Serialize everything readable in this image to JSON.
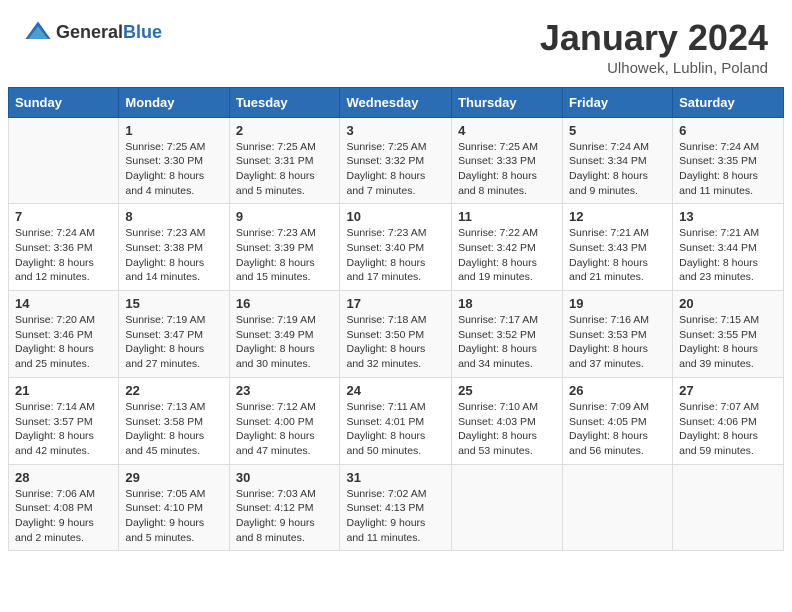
{
  "header": {
    "logo_general": "General",
    "logo_blue": "Blue",
    "month_title": "January 2024",
    "location": "Ulhowek, Lublin, Poland"
  },
  "days_of_week": [
    "Sunday",
    "Monday",
    "Tuesday",
    "Wednesday",
    "Thursday",
    "Friday",
    "Saturday"
  ],
  "weeks": [
    [
      {
        "day": "",
        "sunrise": "",
        "sunset": "",
        "daylight": ""
      },
      {
        "day": "1",
        "sunrise": "Sunrise: 7:25 AM",
        "sunset": "Sunset: 3:30 PM",
        "daylight": "Daylight: 8 hours and 4 minutes."
      },
      {
        "day": "2",
        "sunrise": "Sunrise: 7:25 AM",
        "sunset": "Sunset: 3:31 PM",
        "daylight": "Daylight: 8 hours and 5 minutes."
      },
      {
        "day": "3",
        "sunrise": "Sunrise: 7:25 AM",
        "sunset": "Sunset: 3:32 PM",
        "daylight": "Daylight: 8 hours and 7 minutes."
      },
      {
        "day": "4",
        "sunrise": "Sunrise: 7:25 AM",
        "sunset": "Sunset: 3:33 PM",
        "daylight": "Daylight: 8 hours and 8 minutes."
      },
      {
        "day": "5",
        "sunrise": "Sunrise: 7:24 AM",
        "sunset": "Sunset: 3:34 PM",
        "daylight": "Daylight: 8 hours and 9 minutes."
      },
      {
        "day": "6",
        "sunrise": "Sunrise: 7:24 AM",
        "sunset": "Sunset: 3:35 PM",
        "daylight": "Daylight: 8 hours and 11 minutes."
      }
    ],
    [
      {
        "day": "7",
        "sunrise": "Sunrise: 7:24 AM",
        "sunset": "Sunset: 3:36 PM",
        "daylight": "Daylight: 8 hours and 12 minutes."
      },
      {
        "day": "8",
        "sunrise": "Sunrise: 7:23 AM",
        "sunset": "Sunset: 3:38 PM",
        "daylight": "Daylight: 8 hours and 14 minutes."
      },
      {
        "day": "9",
        "sunrise": "Sunrise: 7:23 AM",
        "sunset": "Sunset: 3:39 PM",
        "daylight": "Daylight: 8 hours and 15 minutes."
      },
      {
        "day": "10",
        "sunrise": "Sunrise: 7:23 AM",
        "sunset": "Sunset: 3:40 PM",
        "daylight": "Daylight: 8 hours and 17 minutes."
      },
      {
        "day": "11",
        "sunrise": "Sunrise: 7:22 AM",
        "sunset": "Sunset: 3:42 PM",
        "daylight": "Daylight: 8 hours and 19 minutes."
      },
      {
        "day": "12",
        "sunrise": "Sunrise: 7:21 AM",
        "sunset": "Sunset: 3:43 PM",
        "daylight": "Daylight: 8 hours and 21 minutes."
      },
      {
        "day": "13",
        "sunrise": "Sunrise: 7:21 AM",
        "sunset": "Sunset: 3:44 PM",
        "daylight": "Daylight: 8 hours and 23 minutes."
      }
    ],
    [
      {
        "day": "14",
        "sunrise": "Sunrise: 7:20 AM",
        "sunset": "Sunset: 3:46 PM",
        "daylight": "Daylight: 8 hours and 25 minutes."
      },
      {
        "day": "15",
        "sunrise": "Sunrise: 7:19 AM",
        "sunset": "Sunset: 3:47 PM",
        "daylight": "Daylight: 8 hours and 27 minutes."
      },
      {
        "day": "16",
        "sunrise": "Sunrise: 7:19 AM",
        "sunset": "Sunset: 3:49 PM",
        "daylight": "Daylight: 8 hours and 30 minutes."
      },
      {
        "day": "17",
        "sunrise": "Sunrise: 7:18 AM",
        "sunset": "Sunset: 3:50 PM",
        "daylight": "Daylight: 8 hours and 32 minutes."
      },
      {
        "day": "18",
        "sunrise": "Sunrise: 7:17 AM",
        "sunset": "Sunset: 3:52 PM",
        "daylight": "Daylight: 8 hours and 34 minutes."
      },
      {
        "day": "19",
        "sunrise": "Sunrise: 7:16 AM",
        "sunset": "Sunset: 3:53 PM",
        "daylight": "Daylight: 8 hours and 37 minutes."
      },
      {
        "day": "20",
        "sunrise": "Sunrise: 7:15 AM",
        "sunset": "Sunset: 3:55 PM",
        "daylight": "Daylight: 8 hours and 39 minutes."
      }
    ],
    [
      {
        "day": "21",
        "sunrise": "Sunrise: 7:14 AM",
        "sunset": "Sunset: 3:57 PM",
        "daylight": "Daylight: 8 hours and 42 minutes."
      },
      {
        "day": "22",
        "sunrise": "Sunrise: 7:13 AM",
        "sunset": "Sunset: 3:58 PM",
        "daylight": "Daylight: 8 hours and 45 minutes."
      },
      {
        "day": "23",
        "sunrise": "Sunrise: 7:12 AM",
        "sunset": "Sunset: 4:00 PM",
        "daylight": "Daylight: 8 hours and 47 minutes."
      },
      {
        "day": "24",
        "sunrise": "Sunrise: 7:11 AM",
        "sunset": "Sunset: 4:01 PM",
        "daylight": "Daylight: 8 hours and 50 minutes."
      },
      {
        "day": "25",
        "sunrise": "Sunrise: 7:10 AM",
        "sunset": "Sunset: 4:03 PM",
        "daylight": "Daylight: 8 hours and 53 minutes."
      },
      {
        "day": "26",
        "sunrise": "Sunrise: 7:09 AM",
        "sunset": "Sunset: 4:05 PM",
        "daylight": "Daylight: 8 hours and 56 minutes."
      },
      {
        "day": "27",
        "sunrise": "Sunrise: 7:07 AM",
        "sunset": "Sunset: 4:06 PM",
        "daylight": "Daylight: 8 hours and 59 minutes."
      }
    ],
    [
      {
        "day": "28",
        "sunrise": "Sunrise: 7:06 AM",
        "sunset": "Sunset: 4:08 PM",
        "daylight": "Daylight: 9 hours and 2 minutes."
      },
      {
        "day": "29",
        "sunrise": "Sunrise: 7:05 AM",
        "sunset": "Sunset: 4:10 PM",
        "daylight": "Daylight: 9 hours and 5 minutes."
      },
      {
        "day": "30",
        "sunrise": "Sunrise: 7:03 AM",
        "sunset": "Sunset: 4:12 PM",
        "daylight": "Daylight: 9 hours and 8 minutes."
      },
      {
        "day": "31",
        "sunrise": "Sunrise: 7:02 AM",
        "sunset": "Sunset: 4:13 PM",
        "daylight": "Daylight: 9 hours and 11 minutes."
      },
      {
        "day": "",
        "sunrise": "",
        "sunset": "",
        "daylight": ""
      },
      {
        "day": "",
        "sunrise": "",
        "sunset": "",
        "daylight": ""
      },
      {
        "day": "",
        "sunrise": "",
        "sunset": "",
        "daylight": ""
      }
    ]
  ]
}
